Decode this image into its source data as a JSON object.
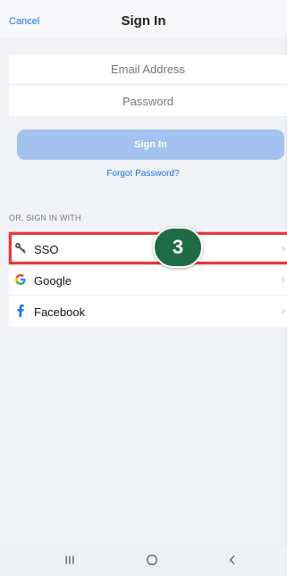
{
  "header": {
    "cancel_label": "Cancel",
    "title": "Sign In"
  },
  "form": {
    "email_placeholder": "Email Address",
    "password_placeholder": "Password",
    "signin_label": "Sign In",
    "forgot_label": "Forgot Password?"
  },
  "alt_signin": {
    "section_label": "OR, SIGN IN WITH",
    "items": [
      {
        "label": "SSO",
        "icon": "key-icon"
      },
      {
        "label": "Google",
        "icon": "google-icon"
      },
      {
        "label": "Facebook",
        "icon": "facebook-icon"
      }
    ]
  },
  "annotation": {
    "step_number": "3",
    "highlight_color": "#e23a3a",
    "badge_color": "#1f6b45"
  },
  "navbar": {
    "recent_icon": "recents-icon",
    "home_icon": "home-icon",
    "back_icon": "back-icon"
  },
  "colors": {
    "link": "#1a73e8",
    "button_disabled": "#a4c2f0"
  }
}
